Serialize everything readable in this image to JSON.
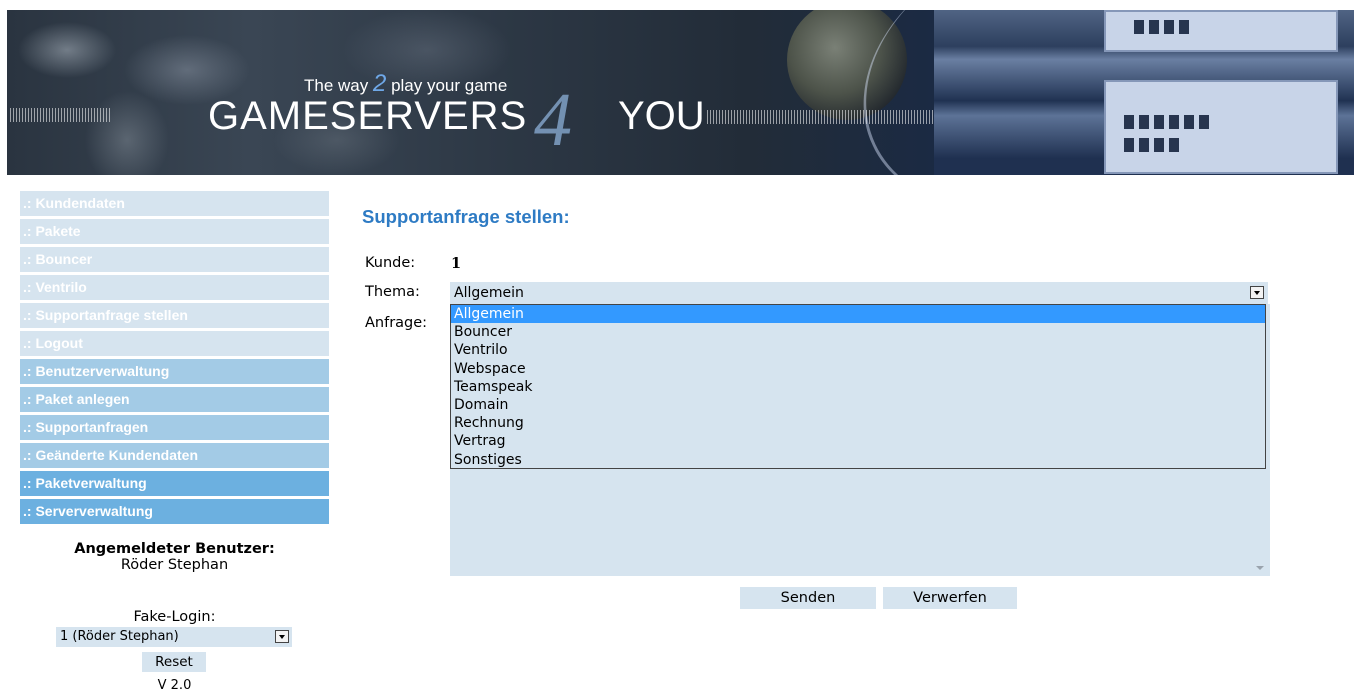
{
  "header": {
    "tagline_before": "The way ",
    "tagline_number": "2",
    "tagline_after": " play your game",
    "brand_left": "GAMESERVERS",
    "brand_number": "4",
    "brand_right": "YOU"
  },
  "sidebar": {
    "items": [
      {
        "label": ".: Kundendaten",
        "style": "light"
      },
      {
        "label": ".: Pakete",
        "style": "light"
      },
      {
        "label": ".: Bouncer",
        "style": "light"
      },
      {
        "label": ".: Ventrilo",
        "style": "light"
      },
      {
        "label": ".: Supportanfrage stellen",
        "style": "light"
      },
      {
        "label": ".: Logout",
        "style": "light"
      },
      {
        "label": ".: Benutzerverwaltung",
        "style": "mid"
      },
      {
        "label": ".: Paket anlegen",
        "style": "mid"
      },
      {
        "label": ".: Supportanfragen",
        "style": "mid"
      },
      {
        "label": ".: Geänderte Kundendaten",
        "style": "mid"
      },
      {
        "label": ".: Paketverwaltung",
        "style": "dark"
      },
      {
        "label": ".: Serververwaltung",
        "style": "dark"
      }
    ],
    "user_heading": "Angemeldeter Benutzer:",
    "user_name": "Röder Stephan",
    "fake_login_label": "Fake-Login:",
    "fake_login_value": "1 (Röder Stephan)",
    "reset_label": "Reset",
    "version": "V 2.0"
  },
  "main": {
    "title": "Supportanfrage stellen:",
    "kunde_label": "Kunde:",
    "kunde_value": "1",
    "thema_label": "Thema:",
    "thema_value": "Allgemein",
    "anfrage_label": "Anfrage:",
    "thema_options": [
      "Allgemein",
      "Bouncer",
      "Ventrilo",
      "Webspace",
      "Teamspeak",
      "Domain",
      "Rechnung",
      "Vertrag",
      "Sonstiges"
    ],
    "thema_selected_index": 0,
    "send_label": "Senden",
    "discard_label": "Verwerfen"
  },
  "colors": {
    "field_bg": "#d6e4ef",
    "nav_light": "#d6e4ef",
    "nav_mid": "#a3cbe6",
    "nav_dark": "#6cb0e0",
    "title_blue": "#2e7bc4",
    "selection_blue": "#3399ff"
  }
}
